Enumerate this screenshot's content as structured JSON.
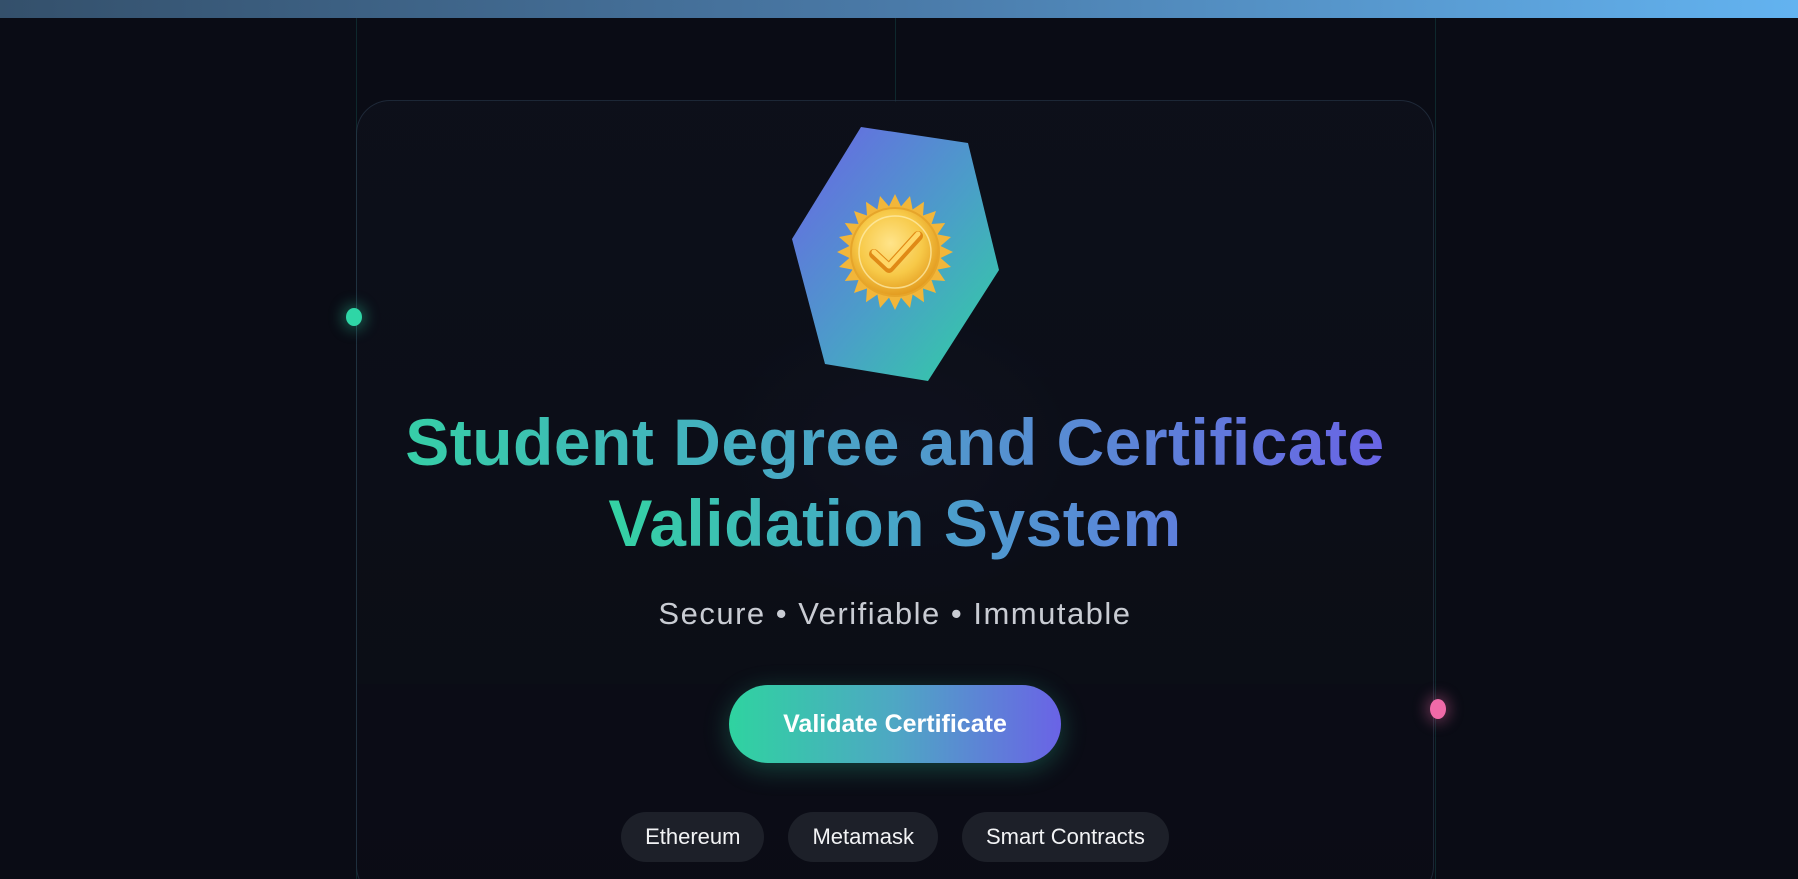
{
  "hero": {
    "title_line1": "Student Degree and Certificate",
    "title_line2": "Validation System",
    "subtitle": "Secure • Verifiable • Immutable",
    "cta_label": "Validate Certificate",
    "tags": [
      "Ethereum",
      "Metamask",
      "Smart Contracts"
    ],
    "emblem_icon": "gold-seal-checkmark-icon"
  },
  "colors": {
    "background": "#0a0c15",
    "accent_teal": "#2fd3a0",
    "accent_violet": "#6a63e6",
    "seal_gold": "#f7c948",
    "orb_pink": "#f06aa8"
  }
}
